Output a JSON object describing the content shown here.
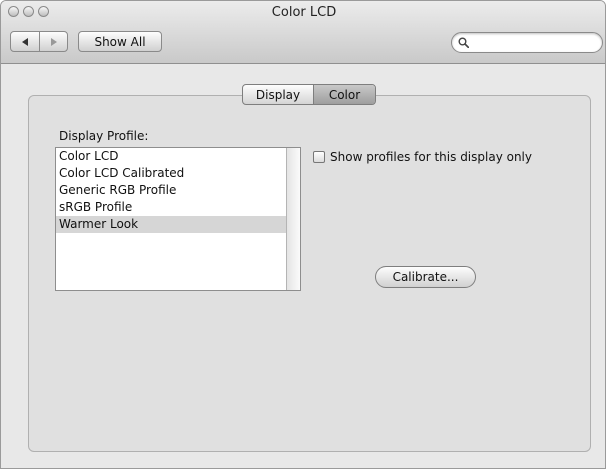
{
  "window": {
    "title": "Color LCD"
  },
  "toolbar": {
    "back_icon": "arrow-left-icon",
    "forward_icon": "arrow-right-icon",
    "show_all_label": "Show All",
    "search": {
      "placeholder": "",
      "value": "",
      "icon": "magnifier-icon"
    }
  },
  "tabs": [
    {
      "label": "Display",
      "selected": false
    },
    {
      "label": "Color",
      "selected": true
    }
  ],
  "profiles": {
    "label": "Display Profile:",
    "items": [
      {
        "label": "Color LCD",
        "selected": false
      },
      {
        "label": "Color LCD Calibrated",
        "selected": false
      },
      {
        "label": "Generic RGB Profile",
        "selected": false
      },
      {
        "label": "sRGB Profile",
        "selected": false
      },
      {
        "label": "Warmer Look",
        "selected": true
      }
    ]
  },
  "options": {
    "show_profiles_label": "Show profiles for this display only",
    "show_profiles_checked": false
  },
  "calibrate_label": "Calibrate..."
}
